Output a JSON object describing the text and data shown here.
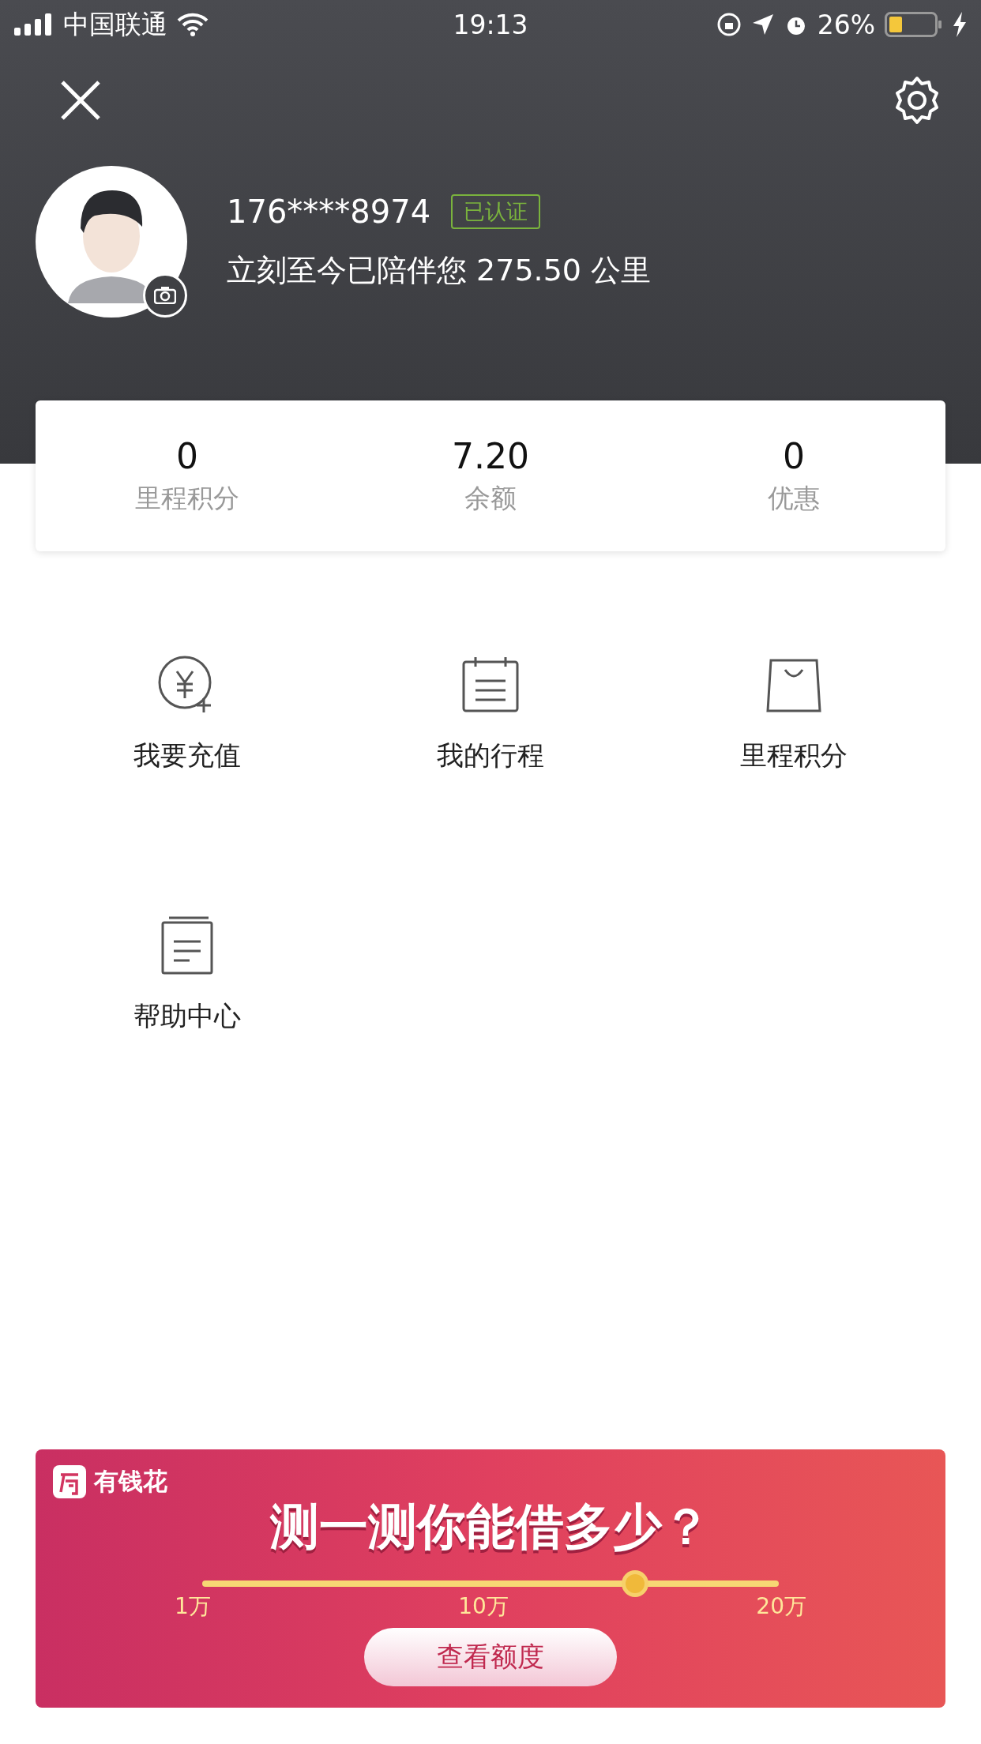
{
  "status_bar": {
    "carrier": "中国联通",
    "time": "19:13",
    "battery": "26%"
  },
  "profile": {
    "phone": "176****8974",
    "badge": "已认证",
    "subtitle": "立刻至今已陪伴您 275.50 公里"
  },
  "stats": [
    {
      "value": "0",
      "label": "里程积分"
    },
    {
      "value": "7.20",
      "label": "余额"
    },
    {
      "value": "0",
      "label": "优惠"
    }
  ],
  "menu": [
    {
      "kind": "recharge",
      "label": "我要充值"
    },
    {
      "kind": "trips",
      "label": "我的行程"
    },
    {
      "kind": "points",
      "label": "里程积分"
    },
    {
      "kind": "help",
      "label": "帮助中心"
    }
  ],
  "banner": {
    "brand": "有钱花",
    "headline": "测一测你能借多少？",
    "scale": [
      "1万",
      "10万",
      "20万"
    ],
    "button": "查看额度"
  }
}
